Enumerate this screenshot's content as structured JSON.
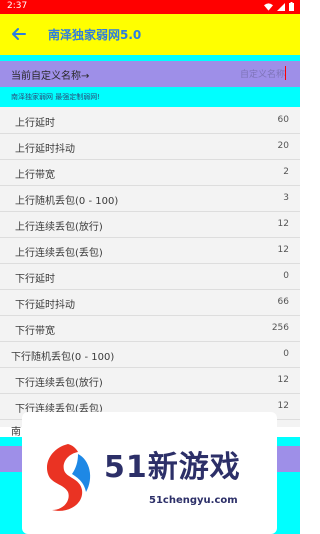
{
  "status_bar": {
    "time": "2:37"
  },
  "app_bar": {
    "title": "南泽独家弱网5.0"
  },
  "config_name": {
    "label": "当前自定义名称→",
    "value": "自定义名称"
  },
  "notice": "南泽独家弱网 最强定制弱网!",
  "settings": [
    {
      "label": "上行延时",
      "value": "60"
    },
    {
      "label": "上行延时抖动",
      "value": "20"
    },
    {
      "label": "上行带宽",
      "value": "2"
    },
    {
      "label": "上行随机丢包(0 - 100)",
      "value": "3"
    },
    {
      "label": "上行连续丢包(放行)",
      "value": "12"
    },
    {
      "label": "上行连续丢包(丢包)",
      "value": "12"
    },
    {
      "label": "下行延时",
      "value": "0"
    },
    {
      "label": "下行延时抖动",
      "value": "66"
    },
    {
      "label": "下行带宽",
      "value": "256"
    },
    {
      "label": "下行随机丢包(0 - 100)",
      "value": "0"
    },
    {
      "label": "下行连续丢包(放行)",
      "value": "12"
    },
    {
      "label": "下行连续丢包(丢包)",
      "value": "12"
    }
  ],
  "partial_row_text": "南",
  "ad": {
    "brand": "51新游戏",
    "url": "51chengyu.com"
  },
  "colors": {
    "status_bar": "#ff0000",
    "app_bar": "#ffff00",
    "title_text": "#2d7de0",
    "cyan": "#00ffff",
    "purple": "#9e8fe8",
    "list_bg": "#f3f3f3"
  }
}
